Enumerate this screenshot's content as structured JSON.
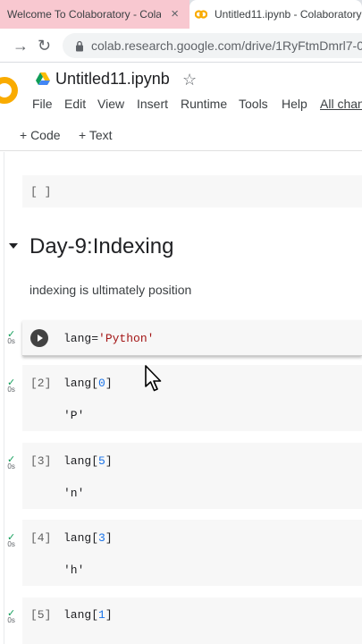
{
  "browser": {
    "tabs": [
      {
        "label": "Welcome To Colaboratory - Colab"
      },
      {
        "label": "Untitled11.ipynb - Colaboratory"
      }
    ],
    "tab_close": "×",
    "url": "colab.research.google.com/drive/1RyFtmDmrl7-0"
  },
  "notebook": {
    "title": "Untitled11.ipynb",
    "menu": [
      "File",
      "Edit",
      "View",
      "Insert",
      "Runtime",
      "Tools",
      "Help",
      "All chan"
    ],
    "toolbar": {
      "add_code": "+ Code",
      "add_text": "+ Text"
    }
  },
  "cells": {
    "empty_prompt": "[ ]",
    "heading": "Day-9:Indexing",
    "text": "indexing is ultimately position",
    "active": {
      "code_var": "lang=",
      "code_str": "'Python'",
      "status_time": "0s"
    },
    "items": [
      {
        "prompt": "[2]",
        "var": "lang[",
        "index": "0",
        "close": "]",
        "output": "'P'",
        "status_time": "0s"
      },
      {
        "prompt": "[3]",
        "var": "lang[",
        "index": "5",
        "close": "]",
        "output": "'n'",
        "status_time": "0s"
      },
      {
        "prompt": "[4]",
        "var": "lang[",
        "index": "3",
        "close": "]",
        "output": "'h'",
        "status_time": "0s"
      },
      {
        "prompt": "[5]",
        "var": "lang[",
        "index": "1",
        "close": "]",
        "output": "",
        "status_time": "0s"
      }
    ]
  },
  "colors": {
    "accent": "#f9ab00",
    "link": "#1a73e8",
    "string": "#a31515",
    "success": "#0f9d58"
  }
}
